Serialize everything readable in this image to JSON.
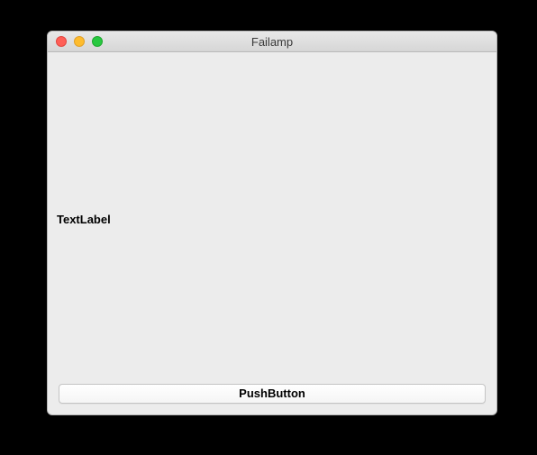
{
  "window": {
    "title": "Failamp"
  },
  "main": {
    "label": "TextLabel"
  },
  "controls": {
    "button_label": "PushButton"
  }
}
